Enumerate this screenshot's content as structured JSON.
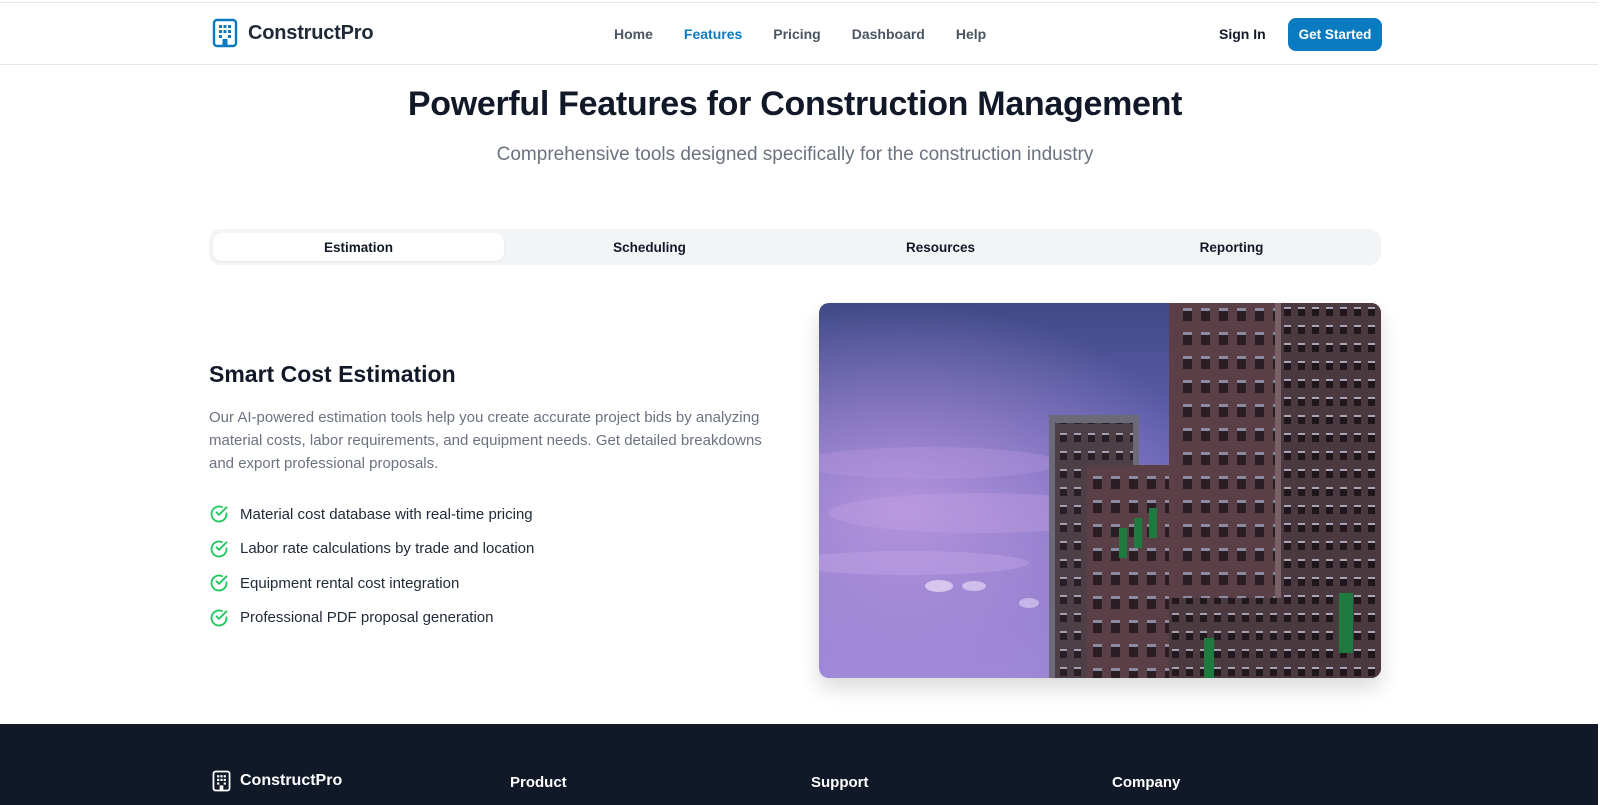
{
  "brand": {
    "name": "ConstructPro",
    "accent": "#0b7bc1",
    "icon": "building-icon"
  },
  "nav": {
    "links": [
      {
        "label": "Home",
        "active": false
      },
      {
        "label": "Features",
        "active": true
      },
      {
        "label": "Pricing",
        "active": false
      },
      {
        "label": "Dashboard",
        "active": false
      },
      {
        "label": "Help",
        "active": false
      }
    ],
    "sign_in": "Sign In",
    "get_started": "Get Started"
  },
  "hero": {
    "title": "Powerful Features for Construction Management",
    "subtitle": "Comprehensive tools designed specifically for the construction industry"
  },
  "tabs": [
    {
      "label": "Estimation",
      "active": true
    },
    {
      "label": "Scheduling",
      "active": false
    },
    {
      "label": "Resources",
      "active": false
    },
    {
      "label": "Reporting",
      "active": false
    }
  ],
  "feature": {
    "title": "Smart Cost Estimation",
    "description": "Our AI-powered estimation tools help you create accurate project bids by analyzing material costs, labor requirements, and equipment needs. Get detailed breakdowns and export professional proposals.",
    "items": [
      "Material cost database with real-time pricing",
      "Labor rate calculations by trade and location",
      "Equipment rental cost integration",
      "Professional PDF proposal generation"
    ],
    "check_color": "#22c55e",
    "image": "building-photo"
  },
  "footer": {
    "brand": "ConstructPro",
    "columns": [
      "Product",
      "Support",
      "Company"
    ],
    "background": "#111827"
  }
}
